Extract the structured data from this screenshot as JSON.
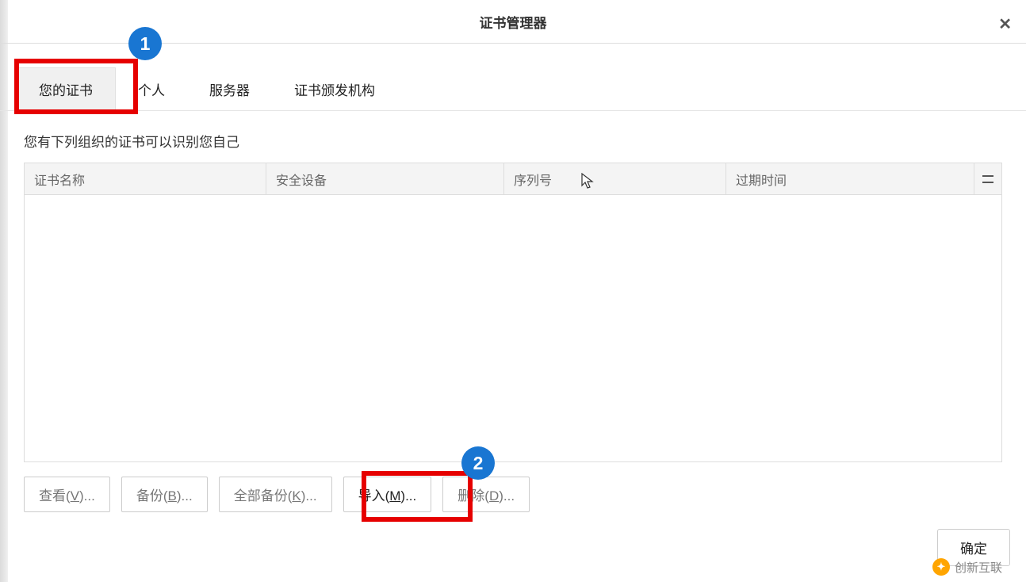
{
  "header": {
    "title": "证书管理器"
  },
  "tabs": [
    {
      "label": "您的证书",
      "active": true
    },
    {
      "label": "个人",
      "active": false
    },
    {
      "label": "服务器",
      "active": false
    },
    {
      "label": "证书颁发机构",
      "active": false
    }
  ],
  "description": "您有下列组织的证书可以识别您自己",
  "table": {
    "columns": {
      "name": "证书名称",
      "device": "安全设备",
      "serial": "序列号",
      "expiry": "过期时间"
    }
  },
  "buttons": {
    "view": {
      "prefix": "查看(",
      "key": "V",
      "suffix": ")..."
    },
    "backup": {
      "prefix": "备份(",
      "key": "B",
      "suffix": ")..."
    },
    "backup_all": {
      "prefix": "全部备份(",
      "key": "K",
      "suffix": ")..."
    },
    "import": {
      "prefix": "导入(",
      "key": "M",
      "suffix": ")..."
    },
    "delete": {
      "prefix": "删除(",
      "key": "D",
      "suffix": ")..."
    }
  },
  "footer": {
    "ok": "确定"
  },
  "annotations": {
    "badge1": "1",
    "badge2": "2"
  },
  "watermark": {
    "text": "创新互联"
  }
}
